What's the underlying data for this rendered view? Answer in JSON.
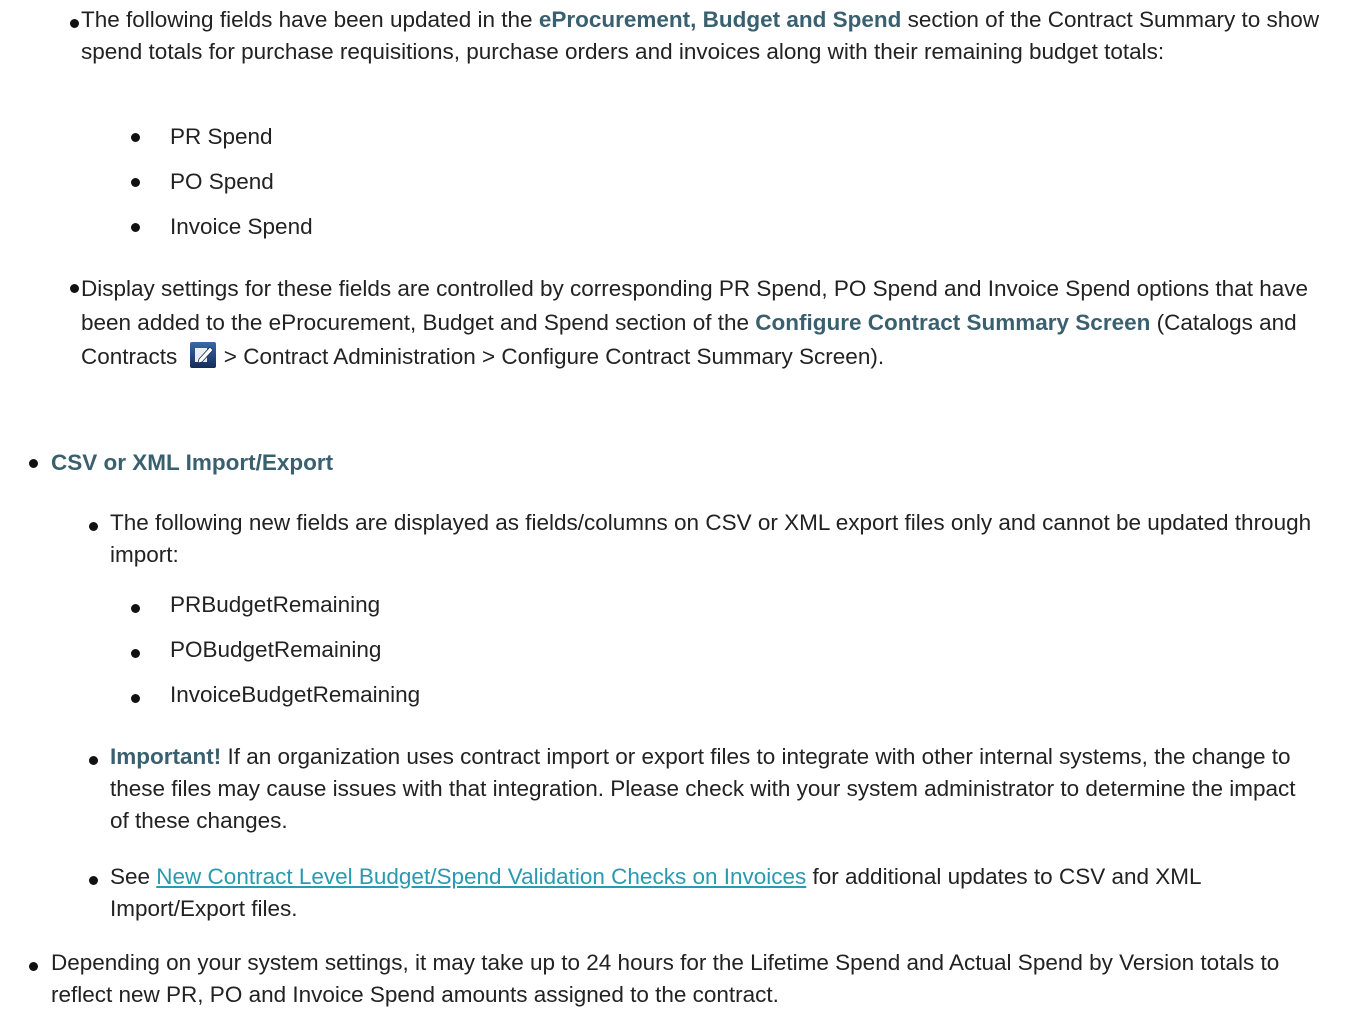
{
  "level1": {
    "fields_updated": {
      "pre": "The following fields have been updated in the ",
      "highlight": "eProcurement, Budget and Spend",
      "post": " section of the Contract Summary to show spend totals for purchase requisitions, purchase orders and invoices along with their remaining budget totals:"
    },
    "spend_items": [
      "PR Spend",
      "PO Spend",
      "Invoice Spend"
    ],
    "display_settings": {
      "pre": "Display settings for these fields are controlled by corresponding PR Spend, PO Spend and Invoice Spend options that have been added to the eProcurement, Budget and Spend section of the ",
      "highlight": "Configure Contract Summary Screen",
      "mid": " (Catalogs and Contracts ",
      "post": " > Contract Administration > Configure Contract Summary Screen).",
      "icon": "edit-icon"
    }
  },
  "csv_heading": "CSV or XML Import/Export",
  "csv": {
    "new_fields_text": "The following new fields are displayed as fields/columns on CSV or XML export files only and cannot be updated through import:",
    "budget_items": [
      "PRBudgetRemaining",
      "POBudgetRemaining",
      "InvoiceBudgetRemaining"
    ],
    "important": {
      "label": "Important!",
      "text": " If an organization uses contract import or export files to integrate with other internal systems, the change to these files may cause issues with that integration. Please check with your system administrator to determine the impact of these changes."
    },
    "see": {
      "pre": "See ",
      "link": "New Contract Level Budget/Spend Validation Checks on Invoices",
      "post": " for additional updates to CSV and XML Import/Export files."
    }
  },
  "final_text": "Depending on your system settings, it may take up to 24 hours for the Lifetime Spend and Actual Spend by Version totals to reflect new PR, PO and Invoice Spend amounts assigned to the contract.",
  "colors": {
    "highlight": "#3a6070",
    "link": "#2a9ab0",
    "text": "#222222",
    "icon_bg": "#1f3f73"
  }
}
